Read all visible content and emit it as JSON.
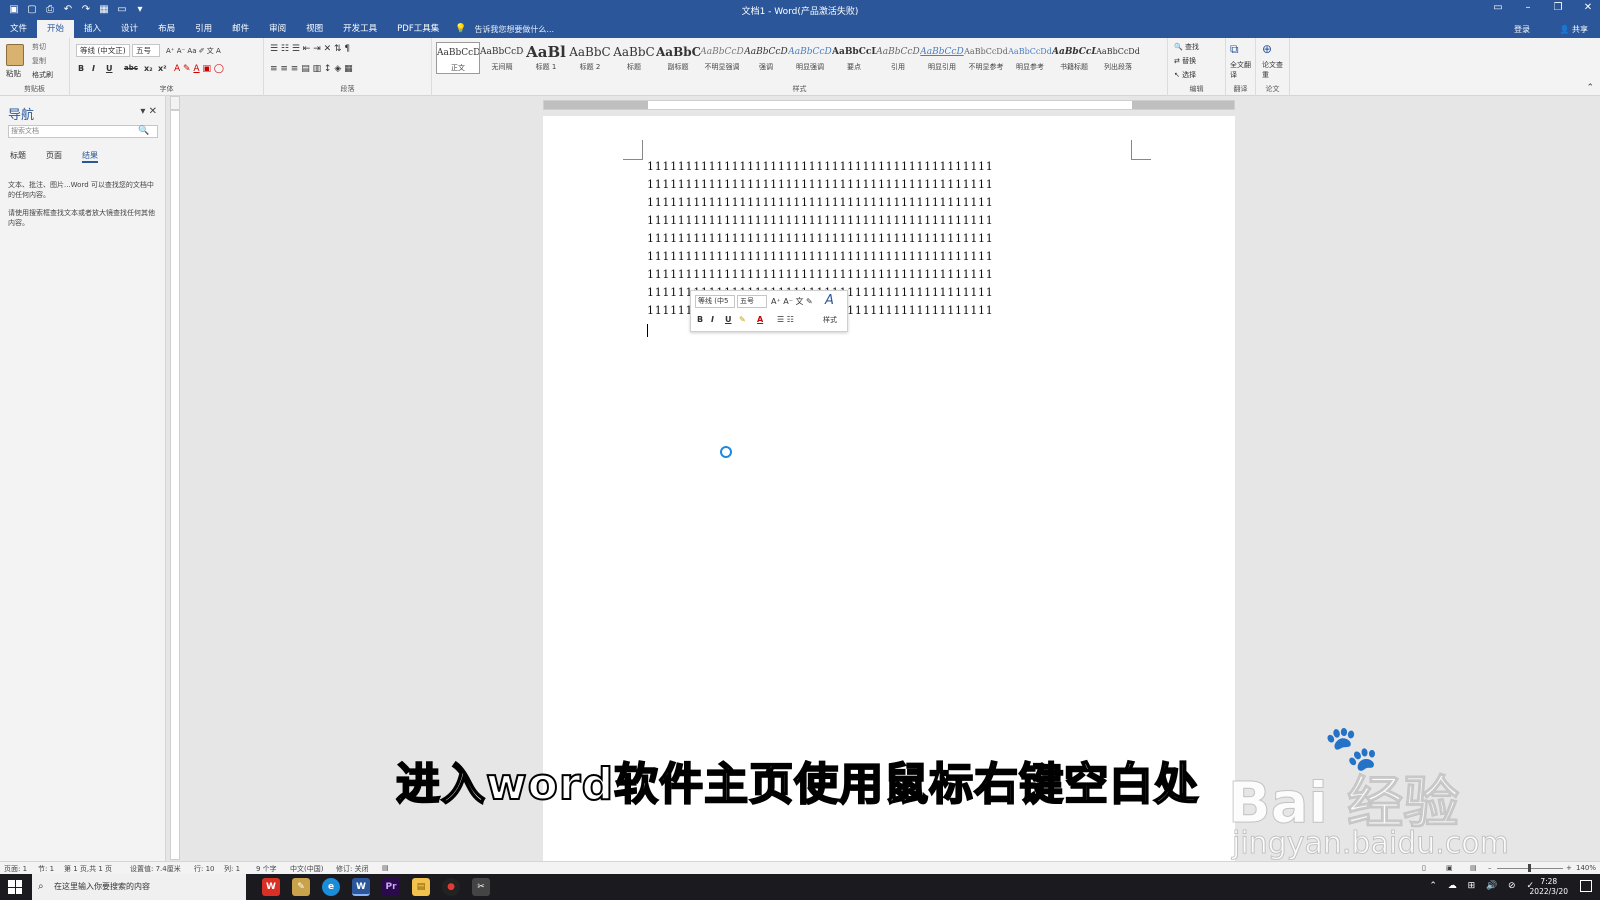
{
  "window": {
    "title": "文档1 - Word(产品激活失败)"
  },
  "qat": [
    "save-icon",
    "new-icon",
    "print-preview-icon",
    "undo-icon",
    "redo-icon",
    "form-icon",
    "open-icon",
    "customize-icon"
  ],
  "tabs": [
    "文件",
    "开始",
    "插入",
    "设计",
    "布局",
    "引用",
    "邮件",
    "审阅",
    "视图",
    "开发工具",
    "PDF工具集"
  ],
  "tell_me": "告诉我您想要做什么...",
  "account": {
    "login": "登录",
    "share": "共享"
  },
  "ribbon": {
    "clipboard": {
      "paste": "粘贴",
      "cut": "剪切",
      "copy": "复制",
      "format_painter": "格式刷",
      "label": "剪贴板"
    },
    "font": {
      "name": "等线 (中文正)",
      "size": "五号",
      "label": "字体",
      "buttons": [
        "B",
        "I",
        "U",
        "abc",
        "x₂",
        "x²"
      ]
    },
    "paragraph": {
      "label": "段落"
    },
    "styles": {
      "label": "样式",
      "items": [
        {
          "sample": "AaBbCcDd",
          "name": "正文"
        },
        {
          "sample": "AaBbCcDd",
          "name": "无间隔"
        },
        {
          "sample": "AaBl",
          "name": "标题 1"
        },
        {
          "sample": "AaBbC",
          "name": "标题 2"
        },
        {
          "sample": "AaBbC",
          "name": "标题"
        },
        {
          "sample": "AaBbC",
          "name": "副标题"
        },
        {
          "sample": "AaBbCcD",
          "name": "不明显强调"
        },
        {
          "sample": "AaBbCcD",
          "name": "强调"
        },
        {
          "sample": "AaBbCcD",
          "name": "明显强调"
        },
        {
          "sample": "AaBbCcD",
          "name": "要点"
        },
        {
          "sample": "AaBbCcD",
          "name": "引用"
        },
        {
          "sample": "AaBbCcD",
          "name": "明显引用"
        },
        {
          "sample": "AaBbCcDd",
          "name": "不明显参考"
        },
        {
          "sample": "AaBbCcDd",
          "name": "明显参考"
        },
        {
          "sample": "AaBbCcD",
          "name": "书籍标题"
        },
        {
          "sample": "AaBbCcDd",
          "name": "列出段落"
        }
      ]
    },
    "editing": {
      "find": "查找",
      "replace": "替换",
      "select": "选择",
      "label": "编辑"
    },
    "translate": {
      "button": "全文翻译",
      "label": "翻译"
    },
    "paper": {
      "button": "论文查重",
      "label": "论文"
    }
  },
  "nav": {
    "title": "导航",
    "search_placeholder": "搜索文档",
    "tabs": [
      "标题",
      "页面",
      "结果"
    ],
    "text1": "文本、批注、图片...Word 可以查找您的文档中的任何内容。",
    "text2": "请使用搜索框查找文本或者放大镜查找任何其他内容。"
  },
  "document": {
    "lines": [
      "111111111111111111111111111111111111111111111",
      "111111111111111111111111111111111111111111111",
      "111111111111111111111111111111111111111111111",
      "111111111111111111111111111111111111111111111",
      "111111111111111111111111111111111111111111111",
      "111111111111111111111111111111111111111111111",
      "111111111111111111111111111111111111111111111",
      "111111111111111111111111111111111111111111111",
      "111111111111111111111111111111111111111111111"
    ]
  },
  "mini_toolbar": {
    "font": "等线 (中5",
    "size": "五号",
    "styles": "样式"
  },
  "status": {
    "page": "页面: 1",
    "section": "节: 1",
    "pages": "第 1 页,共 1 页",
    "position": "设置值: 7.4厘米",
    "row": "行: 10",
    "col": "列: 1",
    "words": "9 个字",
    "lang": "中文(中国)",
    "track": "修订: 关闭",
    "zoom": "140%"
  },
  "taskbar": {
    "search": "在这里输入你要搜索的内容",
    "time": "7:28",
    "date": "2022/3/20",
    "apps": [
      {
        "label": "W",
        "color": "#d93025"
      },
      {
        "label": "✎",
        "color": "#c9a24b"
      },
      {
        "label": "e",
        "color": "#1b8cd8"
      },
      {
        "label": "W",
        "color": "#2b579a"
      },
      {
        "label": "Pr",
        "color": "#2a0a4a"
      },
      {
        "label": "▤",
        "color": "#f2c14e"
      },
      {
        "label": "●",
        "color": "#e53935"
      },
      {
        "label": "✂",
        "color": "#444444"
      }
    ]
  },
  "caption": "进入word软件主页使用鼠标右键空白处",
  "watermark": {
    "brand": "Bai 经验",
    "url": "jingyan.baidu.com"
  }
}
